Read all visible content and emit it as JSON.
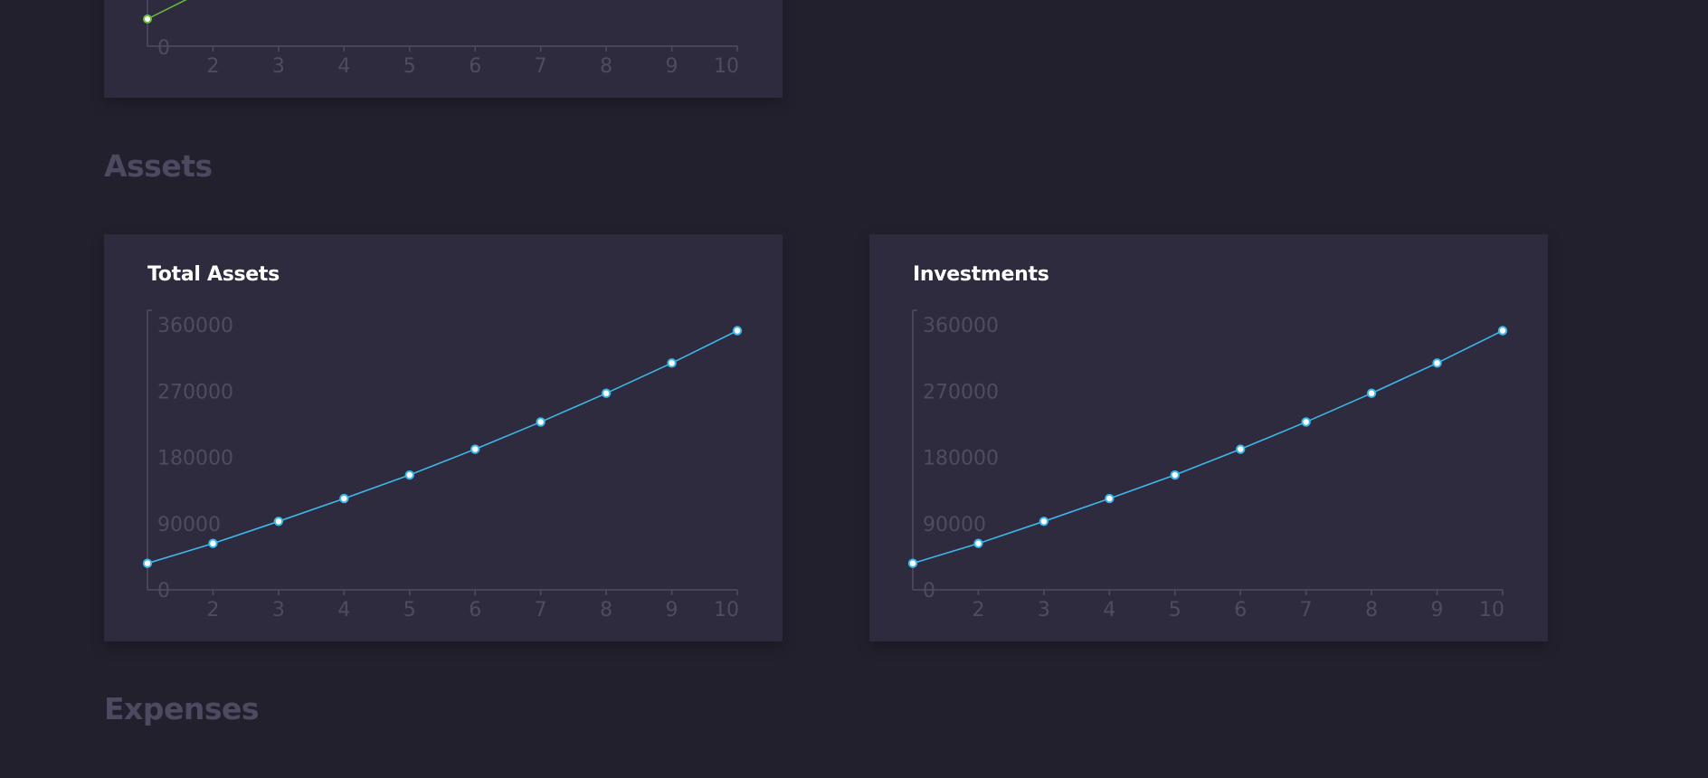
{
  "sections": {
    "assets_heading": "Assets",
    "expenses_heading": "Expenses"
  },
  "colors": {
    "background": "#22202d",
    "card": "#2d2b3d",
    "axis": "#4f4c62",
    "heading": "#4c4960",
    "green_series": "#6bbf44",
    "blue_series": "#3fb6ea"
  },
  "chart_data": [
    {
      "type": "line",
      "title": "",
      "partially_visible": true,
      "x_ticks": [
        "2",
        "3",
        "4",
        "5",
        "6",
        "7",
        "8",
        "9",
        "10"
      ],
      "y_ticks_visible": [
        "0"
      ],
      "series": [
        {
          "color": "#6bbf44",
          "x": [
            1,
            2
          ],
          "y": [
            null,
            null
          ]
        }
      ]
    },
    {
      "type": "line",
      "title": "Total Assets",
      "x_ticks": [
        "2",
        "3",
        "4",
        "5",
        "6",
        "7",
        "8",
        "9",
        "10"
      ],
      "y_ticks": [
        "0",
        "90000",
        "180000",
        "270000",
        "360000"
      ],
      "xlim": [
        1,
        10
      ],
      "ylim": [
        0,
        360000
      ],
      "series": [
        {
          "color": "#3fb6ea",
          "x": [
            1,
            2,
            3,
            4,
            5,
            6,
            7,
            8,
            9,
            10
          ],
          "y": [
            36000,
            63000,
            93000,
            124000,
            156000,
            191000,
            228000,
            267000,
            308000,
            352000
          ]
        }
      ]
    },
    {
      "type": "line",
      "title": "Investments",
      "x_ticks": [
        "2",
        "3",
        "4",
        "5",
        "6",
        "7",
        "8",
        "9",
        "10"
      ],
      "y_ticks": [
        "0",
        "90000",
        "180000",
        "270000",
        "360000"
      ],
      "xlim": [
        1,
        10
      ],
      "ylim": [
        0,
        360000
      ],
      "series": [
        {
          "color": "#3fb6ea",
          "x": [
            1,
            2,
            3,
            4,
            5,
            6,
            7,
            8,
            9,
            10
          ],
          "y": [
            36000,
            63000,
            93000,
            124000,
            156000,
            191000,
            228000,
            267000,
            308000,
            352000
          ]
        }
      ]
    }
  ]
}
